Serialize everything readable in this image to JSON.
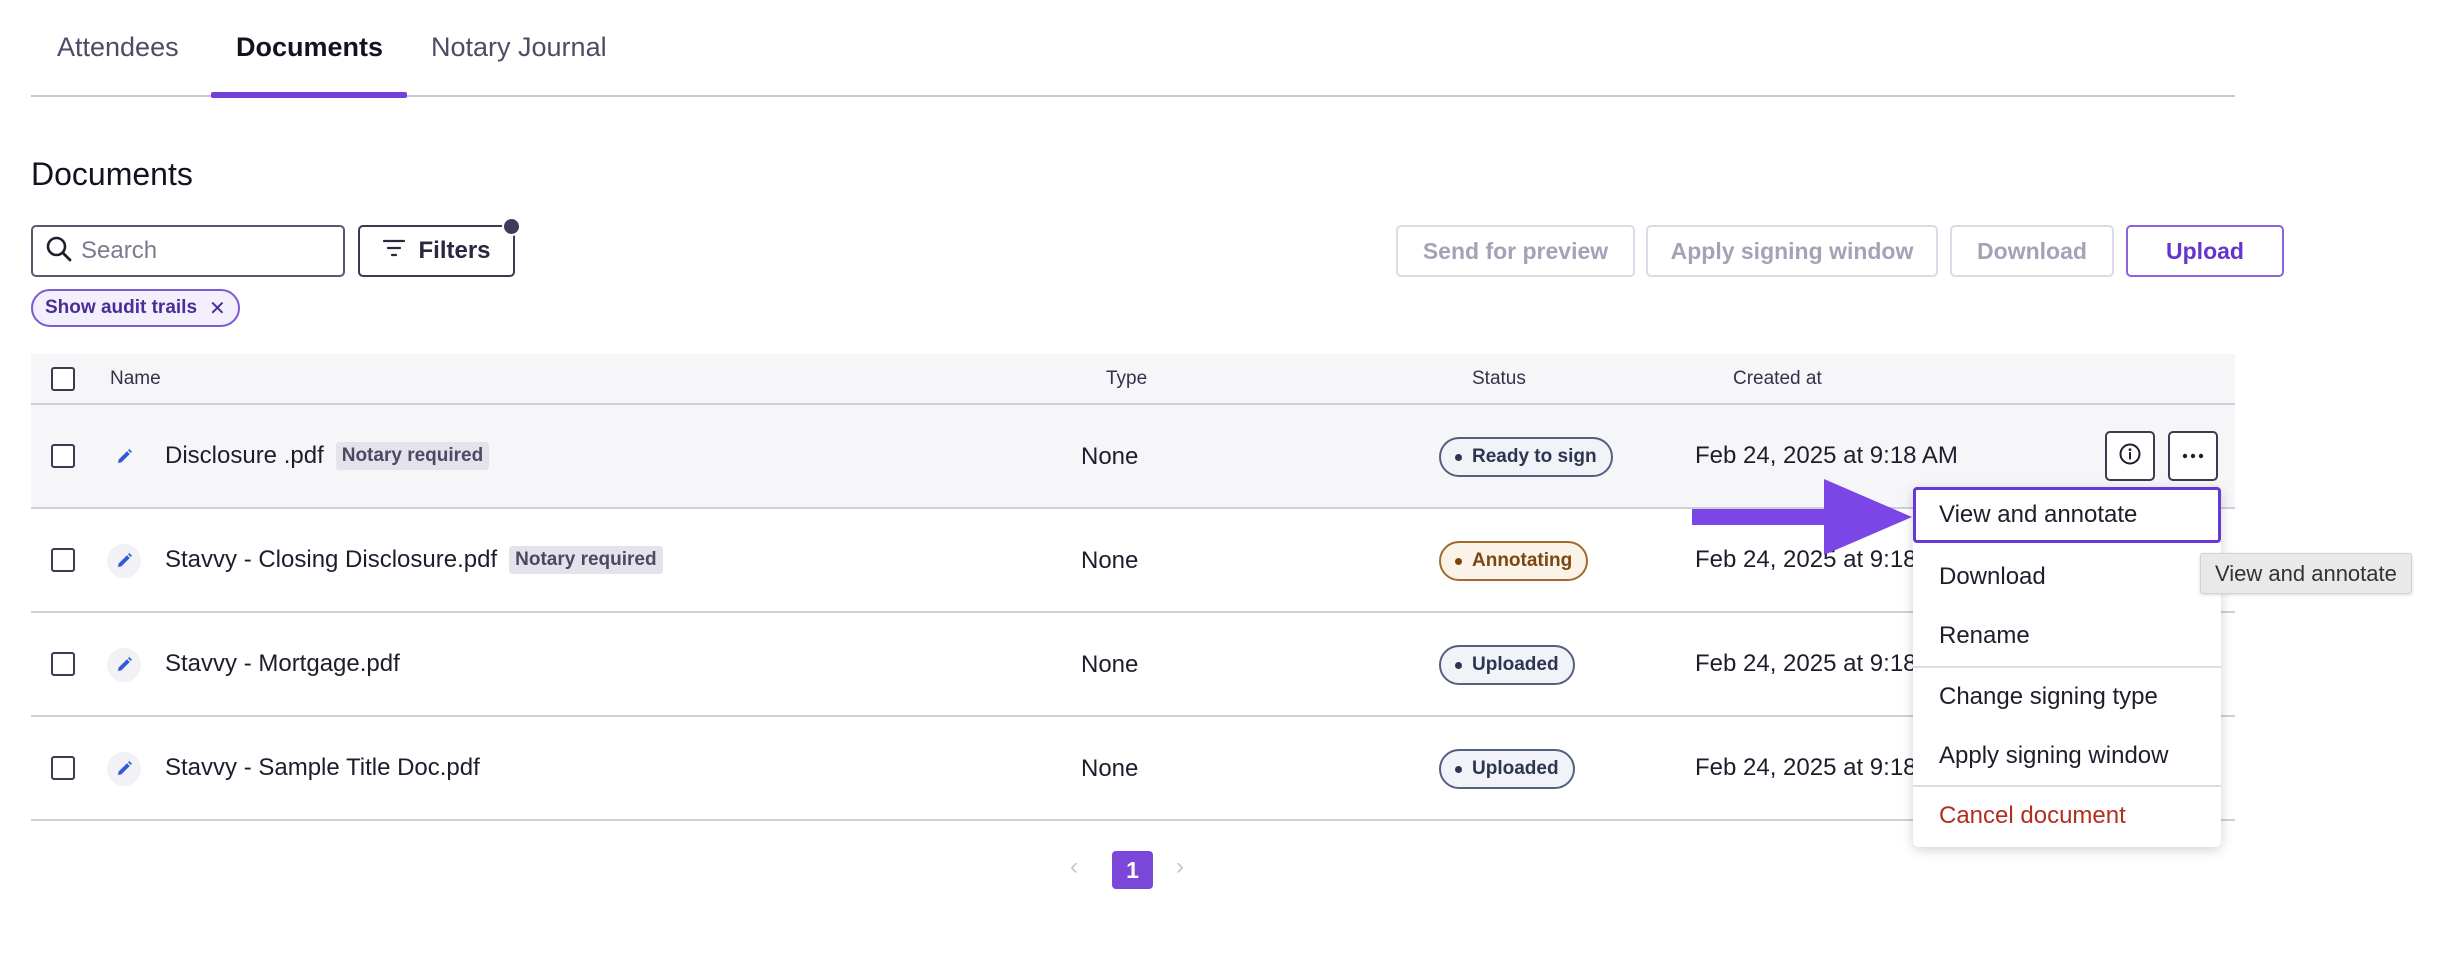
{
  "tabs": [
    {
      "label": "Attendees"
    },
    {
      "label": "Documents"
    },
    {
      "label": "Notary Journal"
    }
  ],
  "section_title": "Documents",
  "search": {
    "placeholder": "Search"
  },
  "toolbar": {
    "filters_label": "Filters",
    "send_preview_label": "Send for preview",
    "apply_window_label": "Apply signing window",
    "download_label": "Download",
    "upload_label": "Upload"
  },
  "active_filter_chip": "Show audit trails",
  "table": {
    "columns": [
      "Name",
      "Type",
      "Status",
      "Created at"
    ],
    "rows": [
      {
        "name": "Disclosure .pdf",
        "badge": "Notary required",
        "type": "None",
        "status": "Ready to sign",
        "created": "Feb 24, 2025 at 9:18 AM"
      },
      {
        "name": "Stavvy - Closing Disclosure.pdf",
        "badge": "Notary required",
        "type": "None",
        "status": "Annotating",
        "created": "Feb 24, 2025 at 9:18"
      },
      {
        "name": "Stavvy - Mortgage.pdf",
        "badge": "",
        "type": "None",
        "status": "Uploaded",
        "created": "Feb 24, 2025 at 9:18"
      },
      {
        "name": "Stavvy - Sample Title Doc.pdf",
        "badge": "",
        "type": "None",
        "status": "Uploaded",
        "created": "Feb 24, 2025 at 9:18"
      }
    ]
  },
  "row_menu": {
    "items": [
      "View and annotate",
      "Download",
      "Rename",
      "Change signing type",
      "Apply signing window",
      "Cancel document"
    ]
  },
  "tooltip": "View and annotate",
  "pagination": {
    "current": "1"
  },
  "colors": {
    "accent": "#7340d8",
    "danger": "#b02f1f",
    "arrow": "#7a47e6"
  },
  "icons": [
    "search-icon",
    "filter-icon",
    "pencil-icon",
    "info-icon",
    "more-icon",
    "close-icon",
    "chevron-left-icon",
    "chevron-right-icon",
    "arrow-pointer-icon"
  ]
}
